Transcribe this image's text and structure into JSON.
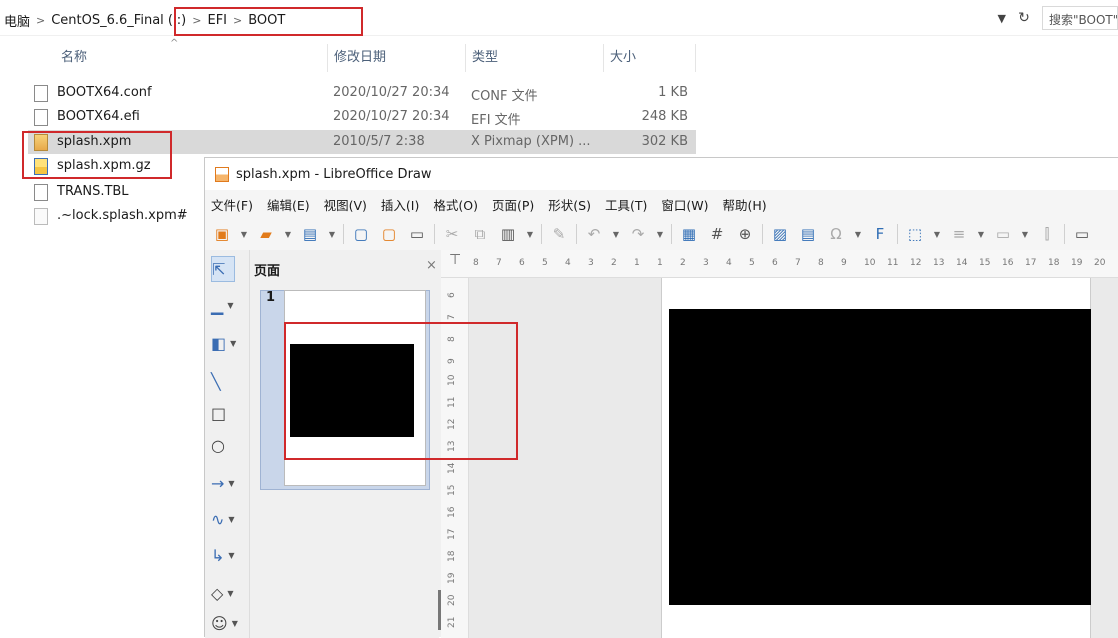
{
  "explorer": {
    "breadcrumb": [
      "电脑",
      "CentOS_6.6_Final (I:)",
      "EFI",
      "BOOT"
    ],
    "search_placeholder": "搜索\"BOOT\"",
    "columns": {
      "name": "名称",
      "date": "修改日期",
      "type": "类型",
      "size": "大小"
    },
    "files": [
      {
        "name": "BOOTX64.conf",
        "date": "2020/10/27 20:34",
        "type": "CONF 文件",
        "size": "1 KB",
        "icon": "doc"
      },
      {
        "name": "BOOTX64.efi",
        "date": "2020/10/27 20:34",
        "type": "EFI 文件",
        "size": "248 KB",
        "icon": "doc"
      },
      {
        "name": "splash.xpm",
        "date": "2010/5/7 2:38",
        "type": "X Pixmap (XPM) ...",
        "size": "302 KB",
        "icon": "image",
        "selected": true
      },
      {
        "name": "splash.xpm.gz",
        "date": "",
        "type": "",
        "size": "",
        "icon": "archive"
      },
      {
        "name": "TRANS.TBL",
        "date": "",
        "type": "",
        "size": "",
        "icon": "doc"
      },
      {
        "name": ".~lock.splash.xpm#",
        "date": "",
        "type": "",
        "size": "",
        "icon": "lock"
      }
    ]
  },
  "libreoffice": {
    "title": "splash.xpm - LibreOffice Draw",
    "menu": [
      "文件(F)",
      "编辑(E)",
      "视图(V)",
      "插入(I)",
      "格式(O)",
      "页面(P)",
      "形状(S)",
      "工具(T)",
      "窗口(W)",
      "帮助(H)"
    ],
    "pages_panel_title": "页面",
    "page_number": "1",
    "hruler_ticks": [
      "8",
      "7",
      "6",
      "5",
      "4",
      "3",
      "2",
      "1",
      "1",
      "2",
      "3",
      "4",
      "5",
      "6",
      "7",
      "8",
      "9",
      "10",
      "11",
      "12",
      "13",
      "14",
      "15",
      "16",
      "17",
      "18",
      "19",
      "20"
    ],
    "vruler_ticks": [
      "6",
      "7",
      "8",
      "9",
      "10",
      "11",
      "12",
      "13",
      "14",
      "15",
      "16",
      "17",
      "18",
      "19",
      "20",
      "21"
    ]
  },
  "colors": {
    "annotation": "#d0292b",
    "selection": "#d9d9d9",
    "panel_select": "#c9d6ea"
  }
}
